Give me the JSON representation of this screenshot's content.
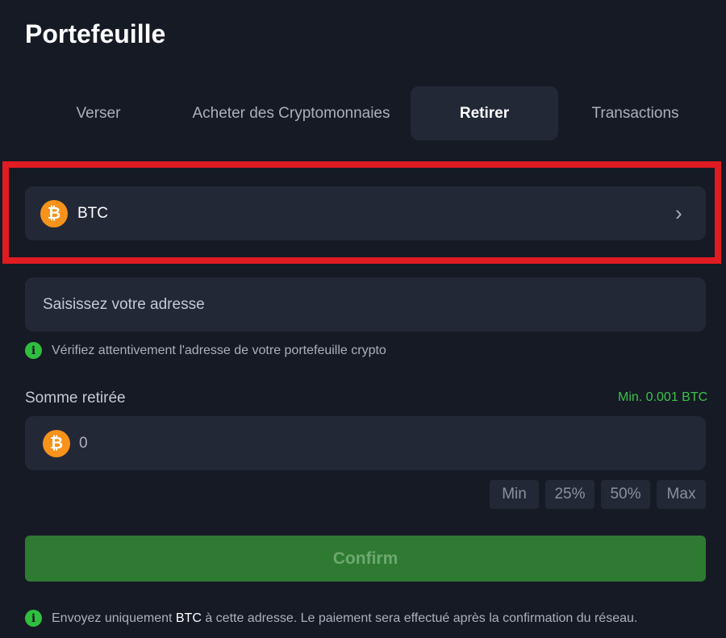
{
  "header": {
    "title": "Portefeuille"
  },
  "tabs": [
    {
      "label": "Verser"
    },
    {
      "label": "Acheter des Cryptomonnaies"
    },
    {
      "label": "Retirer",
      "active": true
    },
    {
      "label": "Transactions"
    }
  ],
  "coin_select": {
    "icon": "bitcoin-icon",
    "symbol": "₿",
    "name": "BTC",
    "chevron": "›"
  },
  "address": {
    "placeholder": "Saisissez votre adresse",
    "value": ""
  },
  "address_note": {
    "icon": "info-icon",
    "glyph": "i",
    "text": "Vérifiez attentivement l'adresse de votre portefeuille crypto"
  },
  "amount": {
    "label": "Somme retirée",
    "min": "Min. 0.001 BTC",
    "value": "0",
    "symbol": "₿",
    "quick_buttons": [
      "Min",
      "25%",
      "50%",
      "Max"
    ]
  },
  "confirm": {
    "label": "Confirm"
  },
  "footer_note": {
    "glyph": "i",
    "prefix": "Envoyez uniquement ",
    "coin": "BTC",
    "suffix": " à cette adresse. Le paiement sera effectué après la confirmation du réseau."
  },
  "colors": {
    "background": "#161a25",
    "panel": "#232837",
    "accent_green": "#2fbf3f",
    "bitcoin_orange": "#f7931a",
    "highlight_red": "#e01b22",
    "confirm_green": "#2f7a32"
  }
}
